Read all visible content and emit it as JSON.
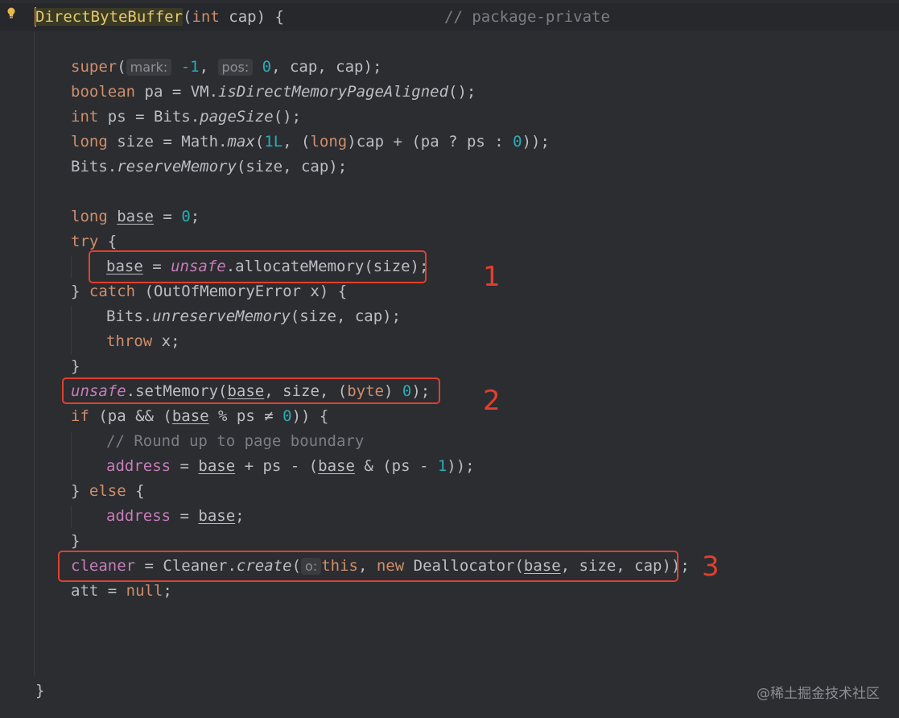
{
  "editor": {
    "l1_class": "DirectByteBuffer",
    "l1_open": "(",
    "l1_kw_int": "int",
    "l1_cap": " cap) {",
    "l1_comment": "// package-private",
    "l3_super": "super",
    "l3_open": "(",
    "l3_hint_mark": "mark:",
    "l3_m1": "-1",
    "l3_comma": ",",
    "l3_hint_pos": "pos:",
    "l3_zero": "0",
    "l3_rest": ", cap, cap);",
    "l4_boolean": "boolean",
    "l4_rest": " pa = VM.",
    "l4_method": "isDirectMemoryPageAligned",
    "l4_end": "();",
    "l5_int": "int",
    "l5_rest": " ps = Bits.",
    "l5_method": "pageSize",
    "l5_end": "();",
    "l6_long": "long",
    "l6_a": " size = Math.",
    "l6_max": "max",
    "l6_b": "(",
    "l6_1L": "1L",
    "l6_c": ", (",
    "l6_long2": "long",
    "l6_d": ")cap + (pa ? ps : ",
    "l6_zero": "0",
    "l6_e": "));",
    "l7_a": "Bits.",
    "l7_method": "reserveMemory",
    "l7_b": "(size, cap);",
    "l9_long": "long",
    "l9_sp": " ",
    "l9_base": "base",
    "l9_eq": " = ",
    "l9_zero": "0",
    "l9_end": ";",
    "l10_try": "try",
    "l10_brace": " {",
    "l11_base": "base",
    "l11_eq": " = ",
    "l11_unsafe": "unsafe",
    "l11_rest": ".allocateMemory(size);",
    "l12_a": "} ",
    "l12_catch": "catch",
    "l12_b": " (OutOfMemoryError x) {",
    "l13_a": "Bits.",
    "l13_method": "unreserveMemory",
    "l13_b": "(size, cap);",
    "l14_throw": "throw",
    "l14_rest": " x;",
    "l15_brace": "}",
    "l16_unsafe": "unsafe",
    "l16_a": ".setMemory(",
    "l16_base": "base",
    "l16_b": ", size, (",
    "l16_byte": "byte",
    "l16_c": ") ",
    "l16_zero": "0",
    "l16_d": ");",
    "l17_if": "if",
    "l17_a": " (pa && (",
    "l17_base": "base",
    "l17_b": " % ps ≠ ",
    "l17_zero": "0",
    "l17_c": ")) {",
    "l18_comment": "// Round up to page boundary",
    "l19_address": "address",
    "l19_a": " = ",
    "l19_base": "base",
    "l19_b": " + ps - (",
    "l19_base2": "base",
    "l19_c": " & (ps - ",
    "l19_one": "1",
    "l19_d": "));",
    "l20_a": "} ",
    "l20_else": "else",
    "l20_b": " {",
    "l21_address": "address",
    "l21_a": " = ",
    "l21_base": "base",
    "l21_end": ";",
    "l22_brace": "}",
    "l23_cleaner": "cleaner",
    "l23_a": " = Cleaner.",
    "l23_create": "create",
    "l23_b": "(",
    "l23_hint_o": "o:",
    "l23_this": "this",
    "l23_c": ", ",
    "l23_new": "new",
    "l23_d": " Deallocator(",
    "l23_base": "base",
    "l23_e": ", size, cap));",
    "l24_att": "att",
    "l24_a": " = ",
    "l24_null": "null",
    "l24_end": ";",
    "l_close": "}"
  },
  "annotations": {
    "n1": "1",
    "n2": "2",
    "n3": "3"
  },
  "watermark": "@稀土掘金技术社区",
  "gutter": {
    "icon": "lightbulb-icon"
  },
  "colors": {
    "keyword": "#cf8e6d",
    "number": "#2aacb8",
    "field": "#c77dbb",
    "comment": "#7a7e85",
    "callout": "#e0402f",
    "background": "#2b2d30"
  }
}
